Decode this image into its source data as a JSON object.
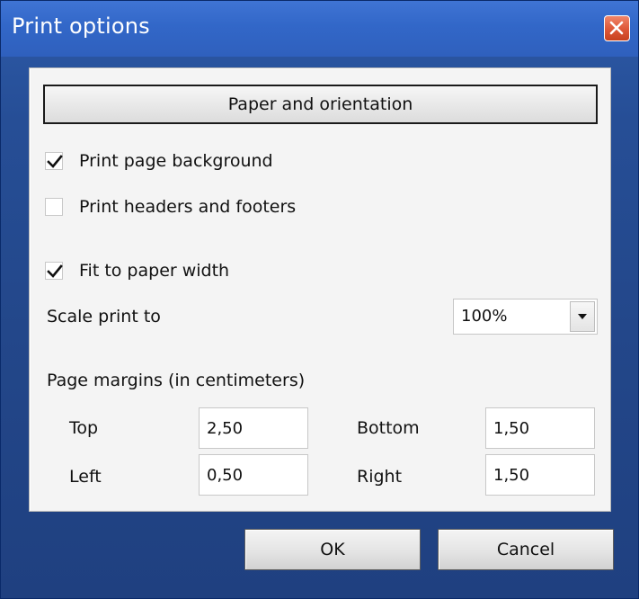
{
  "window": {
    "title": "Print options"
  },
  "panel": {
    "paper_button_label": "Paper and orientation",
    "options": {
      "print_background": {
        "label": "Print page background",
        "checked": true
      },
      "print_headers_footers": {
        "label": "Print headers and footers",
        "checked": false
      },
      "fit_to_width": {
        "label": "Fit to paper width",
        "checked": true
      }
    },
    "scale": {
      "label": "Scale print to",
      "value": "100%"
    },
    "margins": {
      "heading": "Page margins (in centimeters)",
      "top": {
        "label": "Top",
        "value": "2,50"
      },
      "bottom": {
        "label": "Bottom",
        "value": "1,50"
      },
      "left": {
        "label": "Left",
        "value": "0,50"
      },
      "right": {
        "label": "Right",
        "value": "1,50"
      }
    }
  },
  "footer": {
    "ok_label": "OK",
    "cancel_label": "Cancel"
  },
  "icons": {
    "close": "close-icon",
    "check": "checkmark-icon",
    "dropdown": "chevron-down-icon"
  },
  "colors": {
    "title_bar": "#3267c8",
    "frame": "#23478a",
    "close_button": "#df5a3a",
    "panel": "#f4f4f4"
  }
}
